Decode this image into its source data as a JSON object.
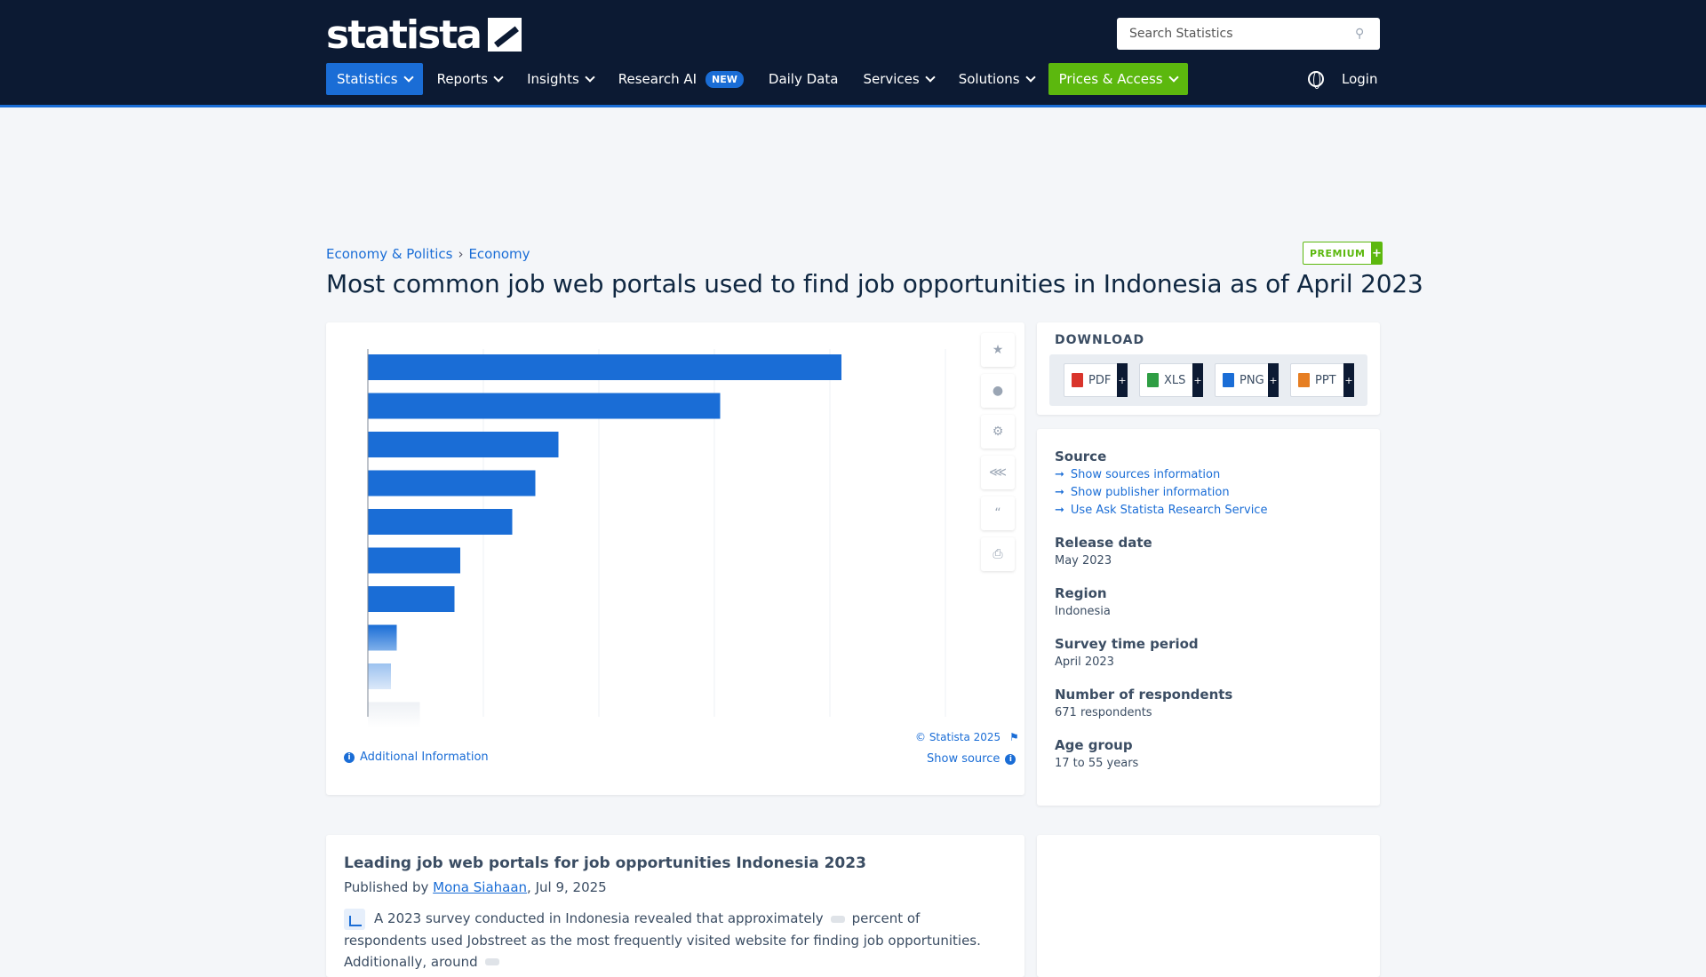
{
  "header": {
    "logo_text": "statista",
    "search_placeholder": "Search Statistics",
    "nav": [
      {
        "label": "Statistics",
        "dropdown": true,
        "active": true
      },
      {
        "label": "Reports",
        "dropdown": true
      },
      {
        "label": "Insights",
        "dropdown": true
      },
      {
        "label": "Research AI",
        "badge": "NEW"
      },
      {
        "label": "Daily Data"
      },
      {
        "label": "Services",
        "dropdown": true
      },
      {
        "label": "Solutions",
        "dropdown": true
      },
      {
        "label": "Prices & Access",
        "dropdown": true
      }
    ],
    "login_label": "Login"
  },
  "breadcrumb": [
    "Economy & Politics",
    "Economy"
  ],
  "premium_label": "PREMIUM",
  "page_title": "Most common job web portals used to find job opportunities in Indonesia as of April 2023",
  "chart": {
    "copyright": "© Statista 2025",
    "additional_info": "Additional Information",
    "show_source": "Show source"
  },
  "chart_data": {
    "type": "bar",
    "orientation": "horizontal",
    "categories": [
      "",
      "",
      "",
      "",
      "",
      "",
      "",
      "",
      "",
      ""
    ],
    "values": [
      82,
      61,
      33,
      29,
      25,
      16,
      15,
      5,
      4,
      9
    ],
    "xlim": [
      0,
      100
    ],
    "note": "category labels and values hidden (premium)"
  },
  "download": {
    "title": "DOWNLOAD",
    "formats": [
      {
        "label": "PDF",
        "color": "#d9342b"
      },
      {
        "label": "XLS",
        "color": "#2f9e44"
      },
      {
        "label": "PNG",
        "color": "#1a6dd6"
      },
      {
        "label": "PPT",
        "color": "#e67e22"
      }
    ]
  },
  "meta": {
    "source_heading": "Source",
    "source_links": [
      "Show sources information",
      "Show publisher information",
      "Use Ask Statista Research Service"
    ],
    "release_date_heading": "Release date",
    "release_date": "May 2023",
    "region_heading": "Region",
    "region": "Indonesia",
    "survey_period_heading": "Survey time period",
    "survey_period": "April 2023",
    "respondents_heading": "Number of respondents",
    "respondents": "671 respondents",
    "age_group_heading": "Age group",
    "age_group": "17 to 55 years"
  },
  "article": {
    "title": "Leading job web portals for job opportunities Indonesia 2023",
    "published_by_prefix": "Published by",
    "author": "Mona Siahaan",
    "date": ", Jul 9, 2025",
    "body_1": "A 2023 survey conducted in Indonesia revealed that approximately",
    "body_2": "percent of respondents used Jobstreet as the most frequently visited website for finding job opportunities. Additionally, around"
  }
}
